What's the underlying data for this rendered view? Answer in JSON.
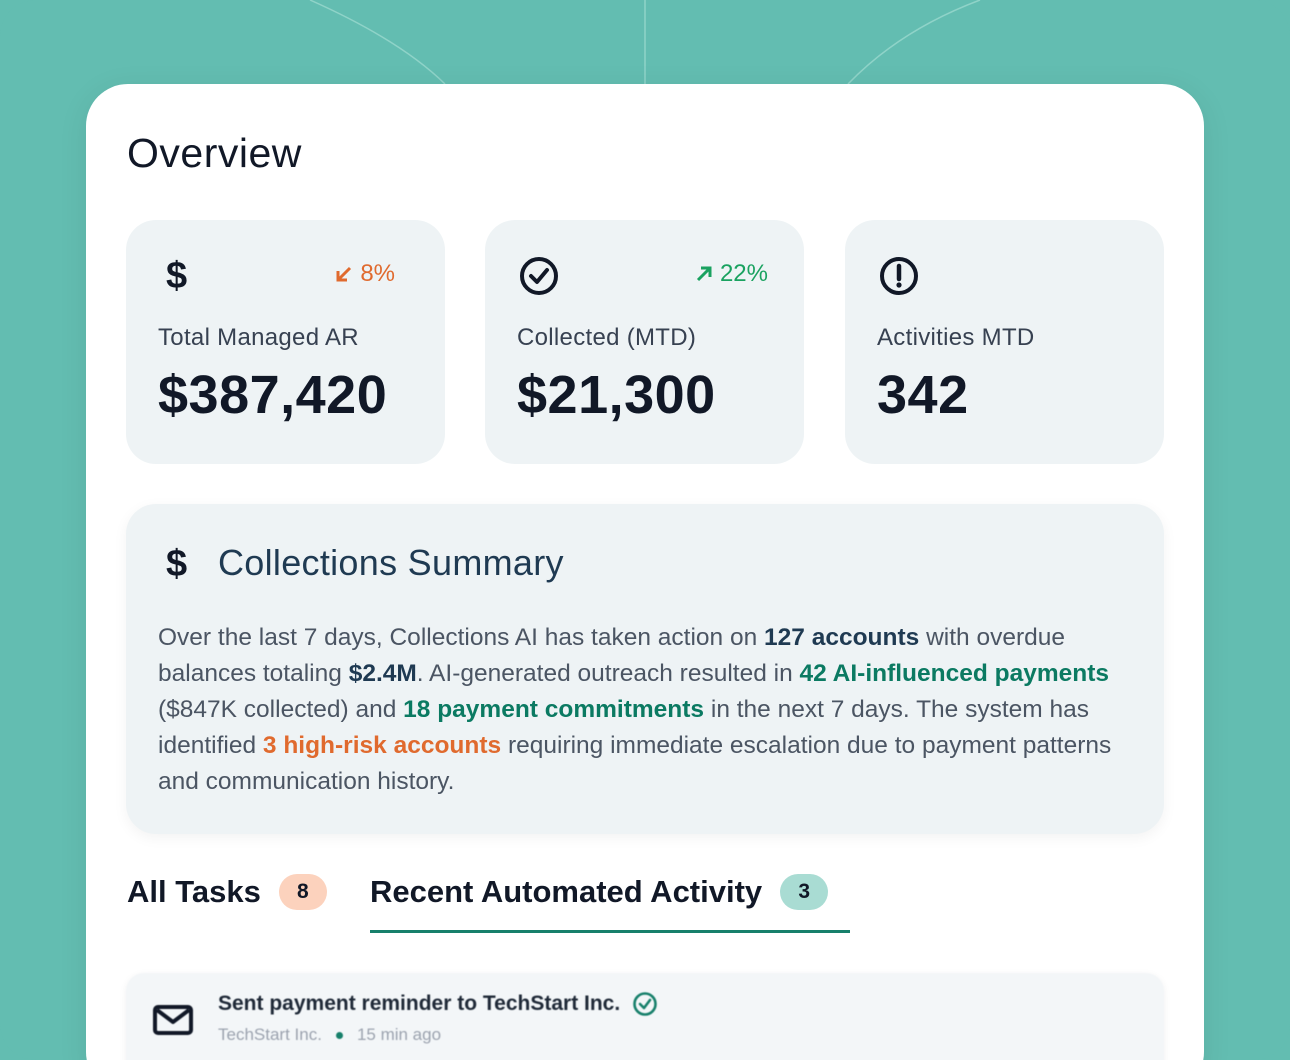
{
  "overview": {
    "title": "Overview"
  },
  "stats": [
    {
      "icon": "dollar-icon",
      "label": "Total Managed AR",
      "value": "$387,420",
      "trend": "8%",
      "trend_dir": "down"
    },
    {
      "icon": "check-circle-icon",
      "label": "Collected (MTD)",
      "value": "$21,300",
      "trend": "22%",
      "trend_dir": "up"
    },
    {
      "icon": "alert-circle-icon",
      "label": "Activities MTD",
      "value": "342"
    }
  ],
  "summary": {
    "title": "Collections Summary",
    "p1": "Over the last 7 days, Collections AI has taken action on ",
    "b1": "127 accounts",
    "p2": " with overdue balances totaling ",
    "b2": "$2.4M",
    "p3": ". AI-generated outreach resulted in ",
    "b3": "42 AI-influenced payments",
    "p4": " ($847K collected) and ",
    "b4": "18 payment commitments",
    "p5": " in the next 7 days. The system has identified ",
    "b5": "3 high-risk accounts",
    "p6": " requiring immediate escalation due to payment patterns and communication history."
  },
  "tabs": [
    {
      "label": "All Tasks",
      "count": "8"
    },
    {
      "label": "Recent Automated Activity",
      "count": "3"
    }
  ],
  "activity": {
    "title": "Sent payment reminder to TechStart Inc.",
    "company": "TechStart Inc.",
    "time": "15 min ago"
  },
  "colors": {
    "accent": "#17806b",
    "down": "#e06a2e",
    "up": "#1aa260",
    "background": "#63bdb1"
  }
}
